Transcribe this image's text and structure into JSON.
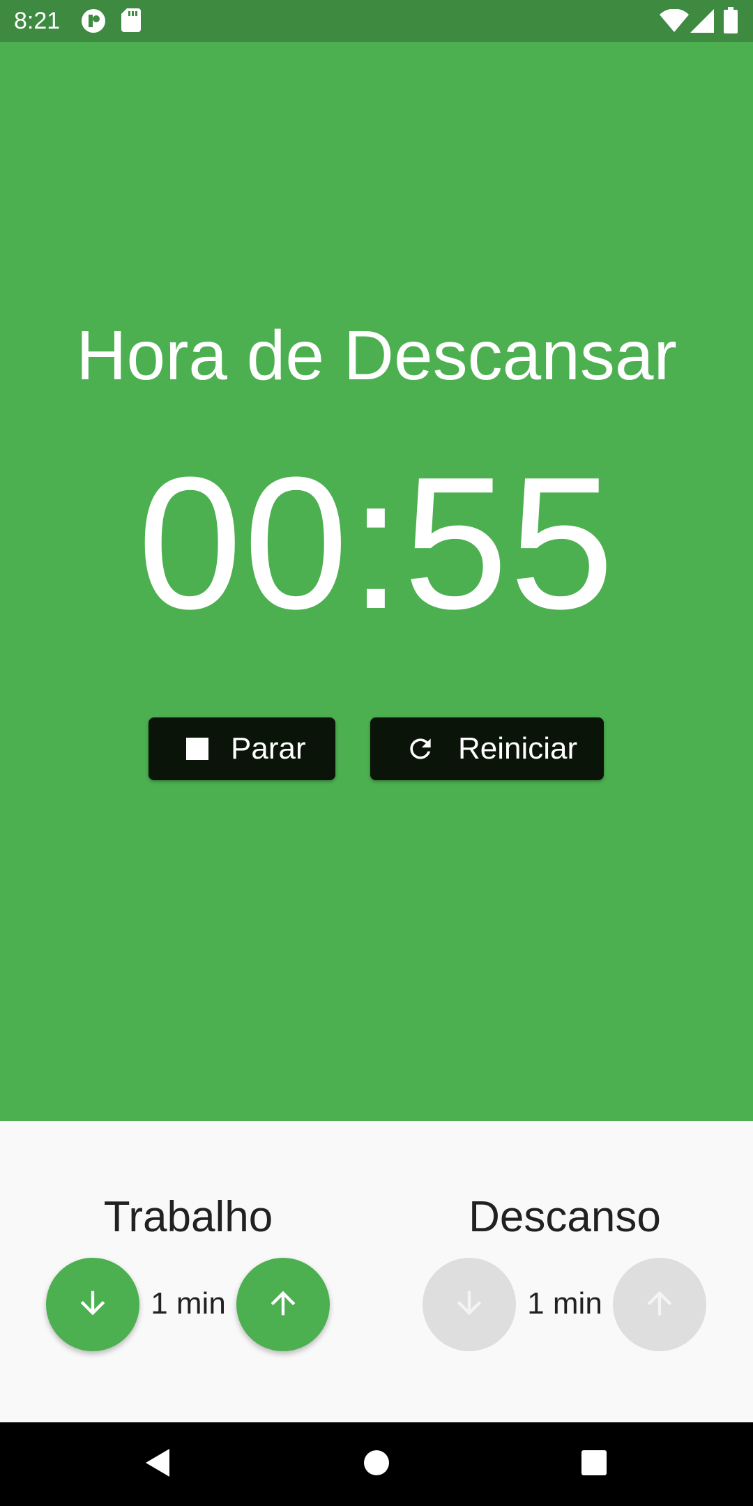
{
  "status_bar": {
    "time": "8:21",
    "icons": [
      "app-notification-icon",
      "sd-card-icon",
      "wifi-icon",
      "signal-icon",
      "battery-icon"
    ]
  },
  "main": {
    "background_color": "#4CAF50",
    "title": "Hora de Descansar",
    "timer": "00:55",
    "stop_button": {
      "label": "Parar",
      "icon": "stop-icon"
    },
    "reset_button": {
      "label": "Reiniciar",
      "icon": "refresh-icon"
    }
  },
  "settings": {
    "work": {
      "title": "Trabalho",
      "value": "1 min",
      "decrease_icon": "arrow-down-icon",
      "increase_icon": "arrow-up-icon",
      "enabled": true
    },
    "rest": {
      "title": "Descanso",
      "value": "1 min",
      "decrease_icon": "arrow-down-icon",
      "increase_icon": "arrow-up-icon",
      "enabled": false
    }
  },
  "nav_bar": {
    "icons": [
      "back-icon",
      "home-icon",
      "recents-icon"
    ]
  }
}
